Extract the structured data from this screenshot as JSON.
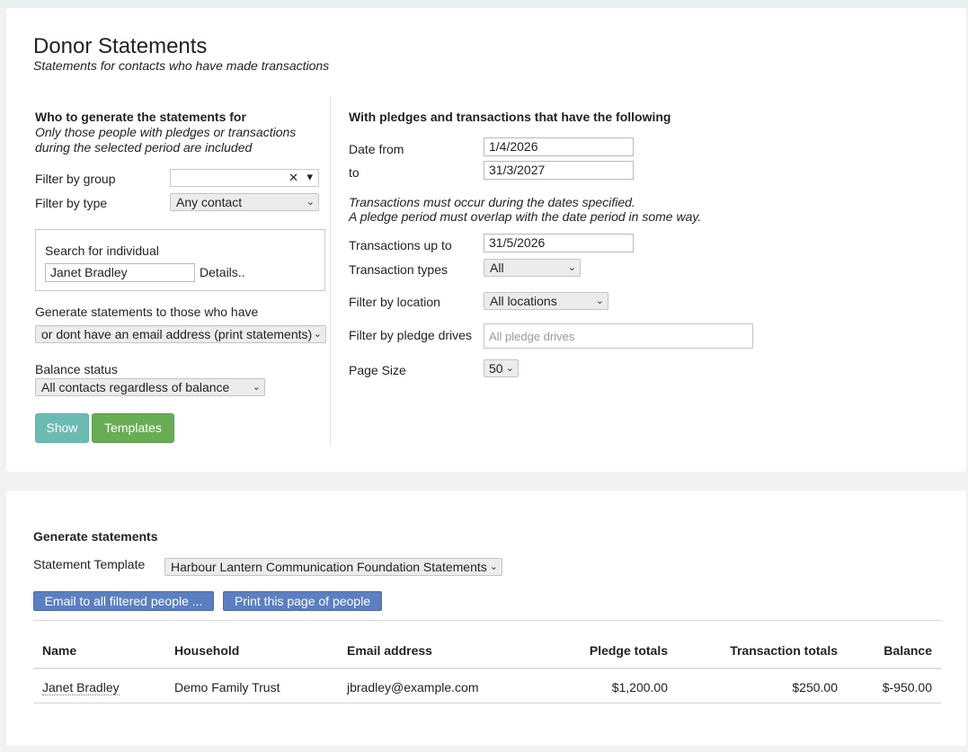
{
  "page": {
    "title": "Donor Statements",
    "subtitle": "Statements for contacts who have made transactions"
  },
  "who": {
    "heading": "Who to generate the statements for",
    "note_line1": "Only those people with pledges or transactions",
    "note_line2": "during the selected period are included",
    "filter_group_label": "Filter by group",
    "filter_group_value": "",
    "filter_type_label": "Filter by type",
    "filter_type_value": "Any contact",
    "search_label": "Search for individual",
    "search_value": "Janet Bradley",
    "details_link": "Details..",
    "generate_label": "Generate statements to those who have",
    "generate_value": "or dont have an email address (print statements)",
    "balance_label": "Balance status",
    "balance_value": "All contacts regardless of balance",
    "show_button": "Show",
    "templates_button": "Templates"
  },
  "criteria": {
    "heading": "With pledges and transactions that have the following",
    "date_from_label": "Date from",
    "date_from_value": "1/4/2026",
    "to_label": "to",
    "to_value": "31/3/2027",
    "note_line1": "Transactions must occur during the dates specified.",
    "note_line2": "A pledge period must overlap with the date period in some way.",
    "tx_up_to_label": "Transactions up to",
    "tx_up_to_value": "31/5/2026",
    "tx_types_label": "Transaction types",
    "tx_types_value": "All",
    "location_label": "Filter by location",
    "location_value": "All locations",
    "drives_label": "Filter by pledge drives",
    "drives_placeholder": "All pledge drives",
    "page_size_label": "Page Size",
    "page_size_value": "50"
  },
  "generate": {
    "heading": "Generate statements",
    "template_label": "Statement Template",
    "template_value": "Harbour Lantern Communication Foundation Statements",
    "email_button": "Email to all filtered people ...",
    "print_button": "Print this page of people"
  },
  "table": {
    "headers": [
      "Name",
      "Household",
      "Email address",
      "Pledge totals",
      "Transaction totals",
      "Balance"
    ],
    "rows": [
      [
        "Janet Bradley",
        "Demo Family Trust",
        "jbradley@example.com",
        "$1,200.00",
        "$250.00",
        "$-950.00"
      ]
    ]
  },
  "icons": {
    "clear": "✕",
    "caret": "▾",
    "chevron": "⌄"
  }
}
